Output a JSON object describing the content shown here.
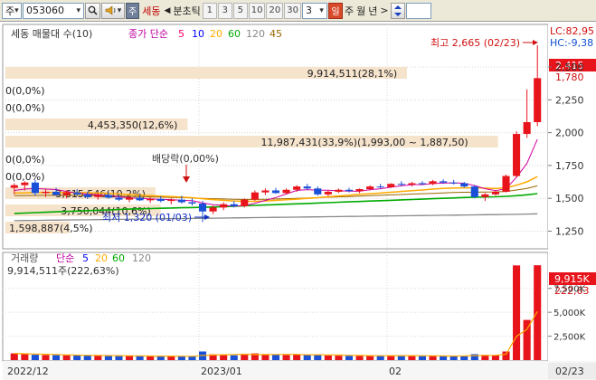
{
  "toolbar": {
    "market_label": "주",
    "code_value": "053060",
    "search_icon": "search-icon",
    "sound_icon": "speaker-icon",
    "stock_badge": "주",
    "stock_name": "세동",
    "nav_prev": "◀",
    "type_label": "분초틱",
    "periods": [
      "1",
      "3",
      "5",
      "10",
      "20",
      "30"
    ],
    "custom_period": "3",
    "active_period": "일",
    "other_periods": [
      "주",
      "월",
      "년"
    ],
    "nav_next": ">"
  },
  "price_legend": {
    "title": "세동 매물대 수(10)",
    "ma_label": "종가 단순",
    "ma_periods": [
      "5",
      "10",
      "20",
      "60",
      "120",
      "45"
    ],
    "ma_colors": [
      "#ff0066",
      "#0000ff",
      "#ffaa00",
      "#00aa00",
      "#888888",
      "#996600"
    ]
  },
  "volume_legend": {
    "title": "거래량",
    "ma_label": "단순",
    "ma_periods": [
      "5",
      "20",
      "60",
      "120"
    ],
    "ma_colors": [
      "#0000ff",
      "#ffaa00",
      "#00aa00",
      "#888888"
    ],
    "current_text": "9,914,511주(222,63%)"
  },
  "volume_profile": [
    {
      "label": "9,914,511(28,1%)",
      "fraction": 0.75
    },
    {
      "label": "0(0,0%)",
      "fraction": 0
    },
    {
      "label": "0(0,0%)",
      "fraction": 0
    },
    {
      "label": "4,453,350(12,6%)",
      "fraction": 0.34
    },
    {
      "label": "11,987,431(33,9%)(1,993,00 ~ 1,887,50)",
      "fraction": 0.92
    },
    {
      "label": "0(0,0%)",
      "fraction": 0
    },
    {
      "label": "0(0,0%)",
      "fraction": 0
    },
    {
      "label": "3,615,546(10,2%)",
      "fraction": 0.28
    },
    {
      "label": "3,750,044(10,6%)",
      "fraction": 0.29
    },
    {
      "label": "1,598,887(4,5%)",
      "fraction": 0.12
    }
  ],
  "annotations": {
    "high": "최고 2,665 (02/23)",
    "low": "최저 1,320 (01/03)",
    "dividend": "배당락(0,00%)"
  },
  "right_axis": {
    "lc": "LC:82,95",
    "hc": "HC:-9,38",
    "current_price": "2,415",
    "prev_price": "1,780",
    "price_ticks": [
      "2,500",
      "2,250",
      "2,000",
      "1,750",
      "1,500",
      "1,250"
    ],
    "price_tick_values": [
      2500,
      2250,
      2000,
      1750,
      1500,
      1250
    ],
    "volume_current": "9,915K",
    "volume_ratio": "222,63",
    "volume_ticks": [
      "7,500K",
      "5,000K",
      "2,500K"
    ],
    "volume_tick_values": [
      7500,
      5000,
      2500
    ]
  },
  "date_axis": {
    "labels": [
      "2022/12",
      "2023/01",
      "02"
    ],
    "current_date": "02/23"
  },
  "colors": {
    "up": "#e8141c",
    "down": "#1a50d8",
    "profile_fill": "#f5e3cc",
    "axis_current": "#e8141c"
  },
  "chart_data": {
    "type": "candlestick",
    "price_axis_range": [
      1150,
      2700
    ],
    "volume_axis_range": [
      0,
      10500
    ],
    "candles": [
      {
        "o": 1580,
        "h": 1615,
        "l": 1530,
        "c": 1600
      },
      {
        "o": 1600,
        "h": 1630,
        "l": 1560,
        "c": 1620
      },
      {
        "o": 1620,
        "h": 1640,
        "l": 1520,
        "c": 1540
      },
      {
        "o": 1540,
        "h": 1570,
        "l": 1510,
        "c": 1550
      },
      {
        "o": 1550,
        "h": 1580,
        "l": 1520,
        "c": 1525
      },
      {
        "o": 1525,
        "h": 1560,
        "l": 1500,
        "c": 1545
      },
      {
        "o": 1545,
        "h": 1570,
        "l": 1520,
        "c": 1530
      },
      {
        "o": 1530,
        "h": 1550,
        "l": 1495,
        "c": 1510
      },
      {
        "o": 1510,
        "h": 1540,
        "l": 1490,
        "c": 1525
      },
      {
        "o": 1525,
        "h": 1545,
        "l": 1500,
        "c": 1505
      },
      {
        "o": 1505,
        "h": 1530,
        "l": 1480,
        "c": 1490
      },
      {
        "o": 1490,
        "h": 1520,
        "l": 1470,
        "c": 1505
      },
      {
        "o": 1505,
        "h": 1525,
        "l": 1480,
        "c": 1485
      },
      {
        "o": 1485,
        "h": 1510,
        "l": 1465,
        "c": 1495
      },
      {
        "o": 1495,
        "h": 1515,
        "l": 1470,
        "c": 1480
      },
      {
        "o": 1480,
        "h": 1500,
        "l": 1455,
        "c": 1490
      },
      {
        "o": 1490,
        "h": 1520,
        "l": 1460,
        "c": 1470
      },
      {
        "o": 1470,
        "h": 1500,
        "l": 1445,
        "c": 1460
      },
      {
        "o": 1460,
        "h": 1480,
        "l": 1320,
        "c": 1400
      },
      {
        "o": 1400,
        "h": 1445,
        "l": 1380,
        "c": 1430
      },
      {
        "o": 1430,
        "h": 1470,
        "l": 1410,
        "c": 1455
      },
      {
        "o": 1455,
        "h": 1480,
        "l": 1430,
        "c": 1440
      },
      {
        "o": 1440,
        "h": 1500,
        "l": 1430,
        "c": 1490
      },
      {
        "o": 1490,
        "h": 1560,
        "l": 1480,
        "c": 1545
      },
      {
        "o": 1545,
        "h": 1575,
        "l": 1525,
        "c": 1560
      },
      {
        "o": 1560,
        "h": 1580,
        "l": 1535,
        "c": 1540
      },
      {
        "o": 1540,
        "h": 1575,
        "l": 1530,
        "c": 1565
      },
      {
        "o": 1565,
        "h": 1600,
        "l": 1550,
        "c": 1590
      },
      {
        "o": 1590,
        "h": 1610,
        "l": 1565,
        "c": 1575
      },
      {
        "o": 1575,
        "h": 1590,
        "l": 1520,
        "c": 1530
      },
      {
        "o": 1530,
        "h": 1560,
        "l": 1515,
        "c": 1550
      },
      {
        "o": 1550,
        "h": 1575,
        "l": 1540,
        "c": 1565
      },
      {
        "o": 1565,
        "h": 1580,
        "l": 1545,
        "c": 1555
      },
      {
        "o": 1555,
        "h": 1575,
        "l": 1540,
        "c": 1570
      },
      {
        "o": 1570,
        "h": 1600,
        "l": 1560,
        "c": 1590
      },
      {
        "o": 1590,
        "h": 1610,
        "l": 1575,
        "c": 1585
      },
      {
        "o": 1585,
        "h": 1615,
        "l": 1580,
        "c": 1610
      },
      {
        "o": 1610,
        "h": 1630,
        "l": 1595,
        "c": 1605
      },
      {
        "o": 1605,
        "h": 1625,
        "l": 1590,
        "c": 1615
      },
      {
        "o": 1615,
        "h": 1630,
        "l": 1600,
        "c": 1610
      },
      {
        "o": 1610,
        "h": 1640,
        "l": 1600,
        "c": 1630
      },
      {
        "o": 1630,
        "h": 1645,
        "l": 1610,
        "c": 1620
      },
      {
        "o": 1620,
        "h": 1640,
        "l": 1605,
        "c": 1615
      },
      {
        "o": 1615,
        "h": 1625,
        "l": 1580,
        "c": 1590
      },
      {
        "o": 1590,
        "h": 1600,
        "l": 1500,
        "c": 1510
      },
      {
        "o": 1510,
        "h": 1540,
        "l": 1480,
        "c": 1530
      },
      {
        "o": 1530,
        "h": 1560,
        "l": 1520,
        "c": 1550
      },
      {
        "o": 1550,
        "h": 1680,
        "l": 1545,
        "c": 1670
      },
      {
        "o": 1670,
        "h": 2010,
        "l": 1660,
        "c": 1990
      },
      {
        "o": 1990,
        "h": 2330,
        "l": 1960,
        "c": 2080
      },
      {
        "o": 2080,
        "h": 2665,
        "l": 2050,
        "c": 2415
      }
    ],
    "volumes": [
      700,
      620,
      560,
      540,
      520,
      500,
      490,
      470,
      460,
      450,
      440,
      430,
      420,
      410,
      400,
      400,
      390,
      380,
      900,
      600,
      520,
      500,
      560,
      700,
      600,
      560,
      540,
      580,
      520,
      600,
      480,
      460,
      450,
      440,
      470,
      460,
      480,
      450,
      440,
      430,
      450,
      420,
      410,
      470,
      620,
      540,
      480,
      900,
      9900,
      4200,
      9915
    ],
    "ma5": [
      1560,
      1570,
      1575,
      1570,
      1567,
      1552,
      1540,
      1532,
      1527,
      1520,
      1512,
      1505,
      1500,
      1495,
      1493,
      1490,
      1485,
      1482,
      1464,
      1452,
      1446,
      1440,
      1444,
      1463,
      1484,
      1506,
      1533,
      1560,
      1566,
      1562,
      1562,
      1557,
      1555,
      1554,
      1566,
      1573,
      1585,
      1595,
      1604,
      1605,
      1612,
      1616,
      1618,
      1614,
      1597,
      1573,
      1559,
      1572,
      1661,
      1765,
      1950
    ],
    "ma20": [
      1540,
      1542,
      1544,
      1545,
      1545,
      1545,
      1544,
      1542,
      1540,
      1537,
      1533,
      1529,
      1525,
      1521,
      1517,
      1513,
      1509,
      1505,
      1497,
      1490,
      1485,
      1480,
      1477,
      1477,
      1480,
      1484,
      1489,
      1494,
      1500,
      1505,
      1512,
      1518,
      1524,
      1530,
      1535,
      1540,
      1546,
      1552,
      1558,
      1563,
      1570,
      1575,
      1578,
      1580,
      1580,
      1578,
      1576,
      1580,
      1600,
      1625,
      1665
    ],
    "ma60": [
      1385,
      1388,
      1391,
      1394,
      1397,
      1400,
      1403,
      1406,
      1409,
      1412,
      1415,
      1418,
      1420,
      1422,
      1424,
      1426,
      1428,
      1430,
      1432,
      1434,
      1437,
      1440,
      1443,
      1446,
      1449,
      1452,
      1455,
      1458,
      1461,
      1464,
      1467,
      1470,
      1473,
      1476,
      1479,
      1482,
      1485,
      1488,
      1491,
      1494,
      1497,
      1500,
      1503,
      1506,
      1508,
      1510,
      1512,
      1515,
      1520,
      1527,
      1536
    ],
    "ma120": [
      1330,
      1331,
      1332,
      1333,
      1334,
      1335,
      1336,
      1337,
      1338,
      1339,
      1340,
      1341,
      1342,
      1343,
      1344,
      1345,
      1346,
      1347,
      1348,
      1349,
      1350,
      1351,
      1352,
      1353,
      1354,
      1355,
      1356,
      1357,
      1358,
      1359,
      1360,
      1361,
      1362,
      1363,
      1364,
      1365,
      1366,
      1367,
      1368,
      1369,
      1370,
      1371,
      1372,
      1373,
      1374,
      1375,
      1376,
      1377,
      1378,
      1380,
      1382
    ],
    "ma45": [
      1520,
      1521,
      1522,
      1523,
      1523,
      1523,
      1522,
      1521,
      1520,
      1519,
      1517,
      1515,
      1513,
      1511,
      1509,
      1507,
      1505,
      1503,
      1500,
      1497,
      1495,
      1493,
      1492,
      1492,
      1493,
      1495,
      1497,
      1500,
      1502,
      1505,
      1508,
      1511,
      1514,
      1517,
      1520,
      1523,
      1526,
      1529,
      1532,
      1535,
      1538,
      1541,
      1544,
      1546,
      1547,
      1548,
      1549,
      1552,
      1563,
      1576,
      1595
    ]
  }
}
